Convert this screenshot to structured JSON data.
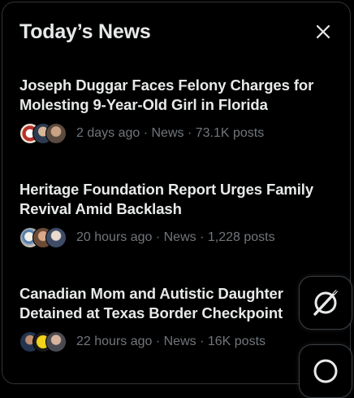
{
  "panel": {
    "title": "Today’s News",
    "close_icon": "close-icon"
  },
  "news": [
    {
      "headline": "Joseph Duggar Faces Felony Charges for Molesting 9-Year-Old Girl in Florida",
      "time": "2 days ago",
      "category": "News",
      "posts": "73.1K posts"
    },
    {
      "headline": "Heritage Foundation Report Urges Family Revival Amid Backlash",
      "time": "20 hours ago",
      "category": "News",
      "posts": "1,228 posts"
    },
    {
      "headline": "Canadian Mom and Autistic Daughter Detained at Texas Border Checkpoint",
      "time": "22 hours ago",
      "category": "News",
      "posts": "16K posts"
    }
  ],
  "floating_buttons": {
    "grok_icon": "grok-icon",
    "messages_icon": "messages-icon"
  },
  "colors": {
    "background": "#000000",
    "text_primary": "#e7e9ea",
    "text_secondary": "#71767b",
    "border": "#2f3336"
  }
}
